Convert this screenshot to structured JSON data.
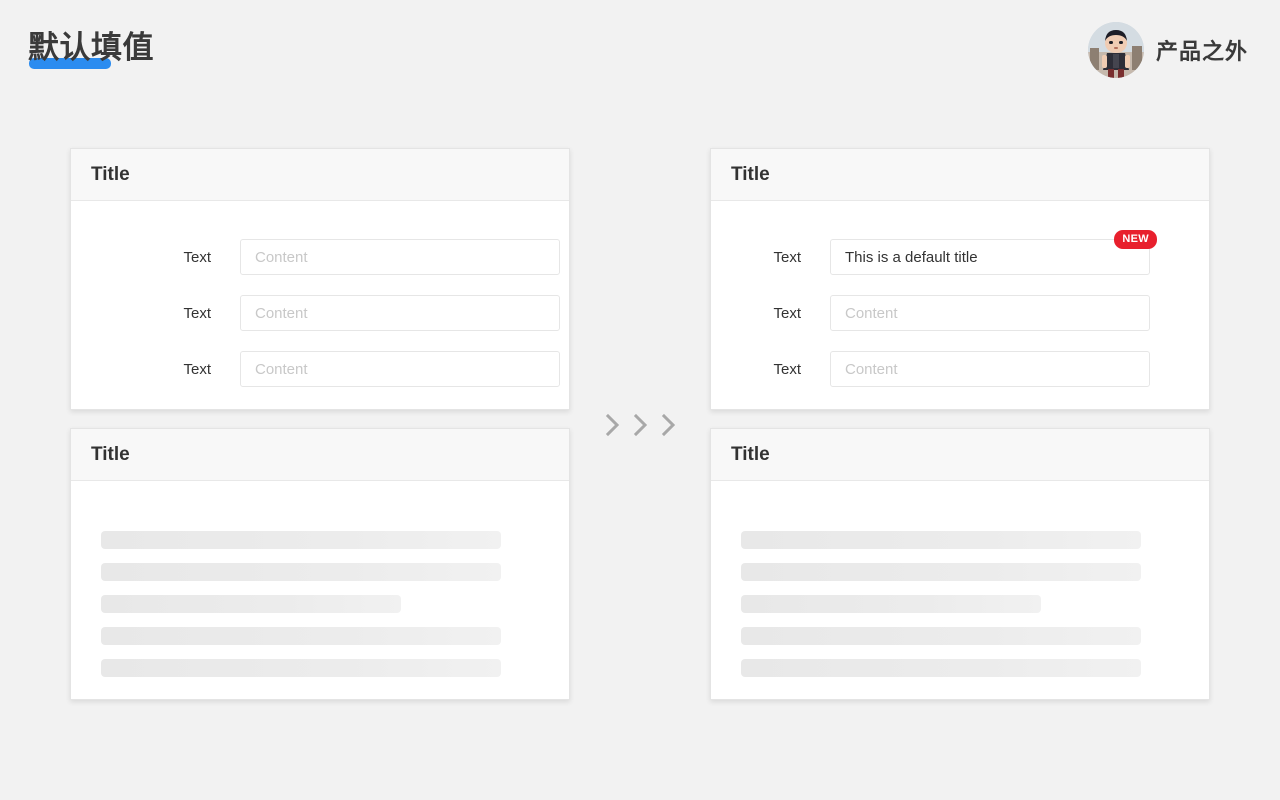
{
  "page": {
    "title": "默认填值",
    "background_color": "#f2f2f2",
    "accent_color": "#2b8cf0"
  },
  "brand": {
    "name": "产品之外",
    "avatar_icon": "avatar-character-icon"
  },
  "arrows": {
    "icon": "chevron-right-icon",
    "count": 3,
    "color": "#a8a8a8"
  },
  "cards": {
    "empty_form": {
      "title": "Title",
      "fields": [
        {
          "label": "Text",
          "value": "",
          "placeholder": "Content"
        },
        {
          "label": "Text",
          "value": "",
          "placeholder": "Content"
        },
        {
          "label": "Text",
          "value": "",
          "placeholder": "Content"
        }
      ]
    },
    "filled_form": {
      "title": "Title",
      "badge": "NEW",
      "badge_color": "#e8202d",
      "fields": [
        {
          "label": "Text",
          "value": "This is a default title",
          "placeholder": ""
        },
        {
          "label": "Text",
          "value": "",
          "placeholder": "Content"
        },
        {
          "label": "Text",
          "value": "",
          "placeholder": "Content"
        }
      ]
    },
    "empty_skeleton": {
      "title": "Title",
      "bars": [
        400,
        400,
        300,
        400,
        400
      ]
    },
    "filled_skeleton": {
      "title": "Title",
      "bars": [
        400,
        400,
        300,
        400,
        400
      ]
    }
  }
}
